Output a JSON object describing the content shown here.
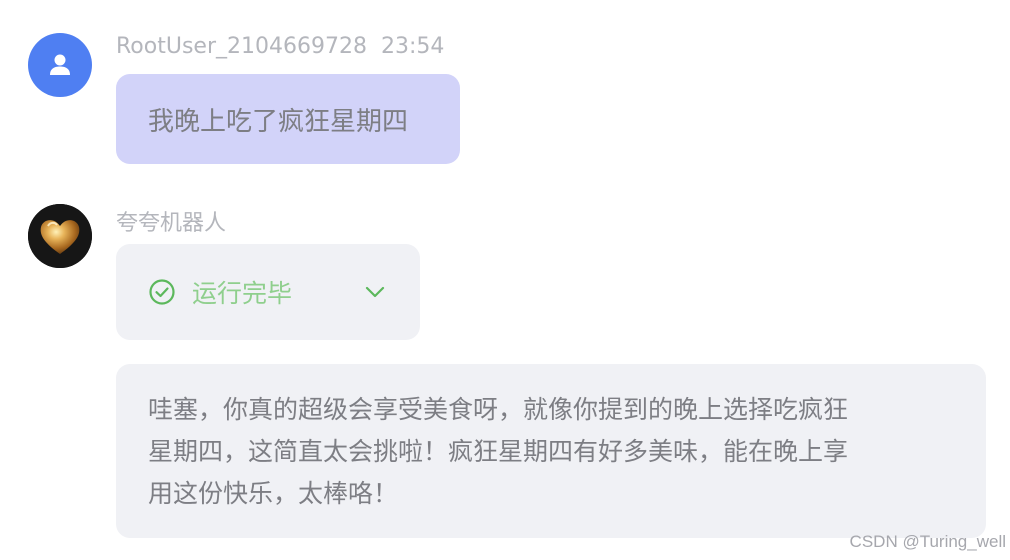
{
  "user_message": {
    "username": "RootUser_2104669728",
    "time": "23:54",
    "text": "我晚上吃了疯狂星期四",
    "avatar_icon": "user-icon",
    "avatar_color": "#4f7ff2",
    "bubble_color": "#d2d3f9"
  },
  "bot_message": {
    "name": "夸夸机器人",
    "avatar_icon": "golden-heart-icon",
    "status": {
      "label": "运行完毕",
      "icon": "check-circle-icon",
      "toggle_icon": "chevron-down-icon",
      "color": "#8fcf8d"
    },
    "lines": [
      "哇塞，你真的超级会享受美食呀，就像你提到的晚上选择吃疯狂",
      "星期四，这简直太会挑啦！疯狂星期四有好多美味，能在晚上享",
      "用这份快乐，太棒咯！"
    ],
    "bubble_color": "#f0f1f5"
  },
  "watermark": "CSDN @Turing_well"
}
